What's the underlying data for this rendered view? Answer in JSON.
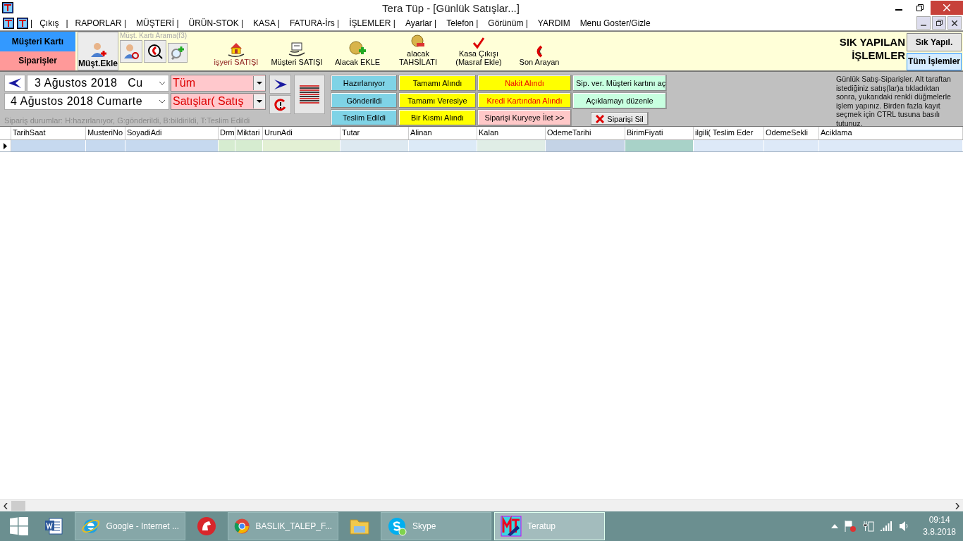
{
  "window": {
    "title": "Tera Tüp - [Günlük Satışlar...]"
  },
  "menu": {
    "items": [
      {
        "label": "|",
        "kind": "separator"
      },
      {
        "label": "Çıkış",
        "kind": "item"
      },
      {
        "label": "|",
        "kind": "separator"
      },
      {
        "label": "RAPORLAR |"
      },
      {
        "label": "MÜŞTERİ |"
      },
      {
        "label": "ÜRÜN-STOK |"
      },
      {
        "label": "KASA |"
      },
      {
        "label": "FATURA-İrs |"
      },
      {
        "label": "İŞLEMLER |"
      },
      {
        "label": "Ayarlar |"
      },
      {
        "label": "Telefon |"
      },
      {
        "label": "Görünüm |"
      },
      {
        "label": "YARDIM"
      },
      {
        "label": "Menu Goster/Gizle"
      }
    ]
  },
  "toolbar": {
    "side_buttons": [
      {
        "label": "Müşteri Kartı",
        "color": "#3399ff"
      },
      {
        "label": "Siparişler",
        "color": "#ff9999"
      }
    ],
    "add_customer": {
      "label": "Müşt.Ekle"
    },
    "search_label": "Müşt. Kartı Arama(f3)",
    "tools": [
      {
        "label": "işyeri SATIŞI",
        "kind": "house"
      },
      {
        "label": "Müşteri SATIŞI",
        "kind": "box"
      },
      {
        "label": "Alacak EKLE",
        "kind": "coin-plus"
      },
      {
        "label": "alacak TAHSİLATI",
        "kind": "coin-minus"
      },
      {
        "label": "Kasa Çıkışı (Masraf Ekle)",
        "kind": "check"
      },
      {
        "label": "Son Arayan",
        "kind": "phone"
      }
    ],
    "heading": "SIK YAPILAN İŞLEMLER",
    "view_buttons": [
      {
        "label": "Sık Yapıl.",
        "selected": false
      },
      {
        "label": "Tüm İşlemler",
        "selected": true
      }
    ]
  },
  "filter": {
    "date_from": "3 Ağustos 2018   Cu",
    "date_to": "4 Ağustos 2018 Cumarte",
    "status_combo": "Tüm",
    "type_combo": "Satışlar( Satış",
    "hint": "Sipariş durumlar: H:hazırlanıyor, G:gönderildi, B:bildirildi, T:Teslim Edildi",
    "action_groups": [
      [
        {
          "label": "Hazırlanıyor",
          "color": "#7fd3e6",
          "kind": "plain"
        },
        {
          "label": "Gönderildi",
          "color": "#7fd3e6",
          "kind": "plain"
        },
        {
          "label": "Teslim Edildi",
          "color": "#7fd3e6",
          "kind": "plain"
        }
      ],
      [
        {
          "label": "Tamamı Alındı",
          "color": "#ffff00",
          "kind": "plain"
        },
        {
          "label": "Tamamı Veresiye",
          "color": "#ffff00",
          "kind": "plain"
        },
        {
          "label": "Bir Kısmı Alındı",
          "color": "#ffff00",
          "kind": "plain"
        }
      ],
      [
        {
          "label": "Nakit Alındı",
          "color": "#ffff00",
          "kind": "alert"
        },
        {
          "label": "Kredi Kartından Alındı",
          "color": "#ffff00",
          "kind": "alert"
        },
        {
          "label": "Siparişi Kuryeye İlet >>",
          "color": "#ffc8c8",
          "kind": "plain"
        }
      ],
      [
        {
          "label": "Sip. ver. Müşteri kartını aç",
          "color": "#c8ffe0",
          "kind": "plain"
        },
        {
          "label": "Açıklamayı düzenle",
          "color": "#c8ffe0",
          "kind": "plain"
        },
        {
          "label": "Siparişi Sil",
          "color": "#e8e8e8",
          "kind": "delete"
        }
      ]
    ],
    "info": "Günlük Satış-Siparişler.   Alt taraftan istediğiniz satış(lar)a tıkladıktan sonra, yukarıdaki renkli düğmelerle işlem yapınız. Birden fazla kayıt seçmek için CTRL tusuna basılı tutunuz."
  },
  "grid": {
    "columns": [
      {
        "name": "TarihSaat",
        "color": "#c6d9ef"
      },
      {
        "name": "MusteriNo",
        "color": "#c6d9ef"
      },
      {
        "name": "SoyadiAdi",
        "color": "#c6d9ef"
      },
      {
        "name": "Drm",
        "color": "#d6ecd0"
      },
      {
        "name": "Miktari",
        "color": "#d6ecd0"
      },
      {
        "name": "UrunAdi",
        "color": "#e3f0d4"
      },
      {
        "name": "Tutar",
        "color": "#dde9f1"
      },
      {
        "name": "Alinan",
        "color": "#dceaf7"
      },
      {
        "name": "Kalan",
        "color": "#e0ede6"
      },
      {
        "name": "OdemeTarihi",
        "color": "#c4d3e6"
      },
      {
        "name": "BirimFiyati",
        "color": "#a8d2c8"
      },
      {
        "name": "ilgili( Teslim Eder",
        "color": "#dde9f8"
      },
      {
        "name": "OdemeSekli",
        "color": "#dde9f8"
      },
      {
        "name": "Aciklama",
        "color": "#dde9f8"
      }
    ],
    "rows": [
      {
        "current": true
      }
    ]
  },
  "taskbar": {
    "items": [
      {
        "kind": "word",
        "active": false
      },
      {
        "kind": "ie",
        "label": "Google - Internet ...",
        "active": false
      },
      {
        "kind": "delphi",
        "active": false
      },
      {
        "kind": "chrome",
        "label": "BASLIK_TALEP_F...",
        "active": false
      },
      {
        "kind": "folder",
        "active": false
      },
      {
        "kind": "skype",
        "label": "Skype",
        "active": false
      },
      {
        "kind": "app",
        "label": "Teratup",
        "active": true
      }
    ],
    "time": "09:14",
    "date": "3.8.2018"
  }
}
